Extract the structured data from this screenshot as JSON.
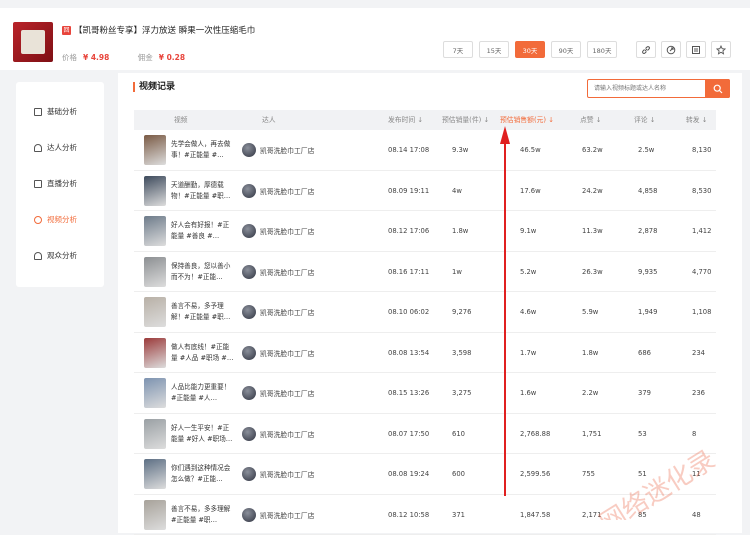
{
  "product": {
    "badge": "回",
    "title": "【凯哥粉丝专享】浮力放送 瞬果一次性压缩毛巾",
    "price_label": "价格",
    "price_value": "¥ 4.98",
    "commission_label": "佣金",
    "commission_value": "¥ 0.28"
  },
  "day_filters": [
    "7天",
    "15天",
    "30天",
    "90天",
    "180天"
  ],
  "active_filter": "30天",
  "tools": [
    "link-icon",
    "share-icon",
    "chart-icon",
    "star-icon"
  ],
  "sidebar": {
    "items": [
      {
        "label": "基础分析",
        "icon": "chart-doc-icon"
      },
      {
        "label": "达人分析",
        "icon": "user-icon"
      },
      {
        "label": "直播分析",
        "icon": "tv-icon"
      },
      {
        "label": "视频分析",
        "icon": "play-circle-icon",
        "active": true
      },
      {
        "label": "观众分析",
        "icon": "audience-icon"
      }
    ]
  },
  "section_title": "视频记录",
  "search": {
    "placeholder": "请输入视频标题或达人名称"
  },
  "table": {
    "headers": {
      "video": "视频",
      "creator": "达人",
      "time": "发布时间 ↓",
      "sales": "预估销量(件) ↓",
      "revenue": "预估销售额(元) ↓",
      "likes": "点赞 ↓",
      "comments": "评论 ↓",
      "shares": "转发 ↓"
    },
    "rows": [
      {
        "title": "先学会做人，再去做事！#正能量 #…",
        "creator": "凯哥洗脸巾工厂店",
        "time": "08.14 17:08",
        "sales": "9.3w",
        "revenue": "46.5w",
        "likes": "63.2w",
        "comments": "2.5w",
        "shares": "8,130",
        "thumb": "#7a5a44"
      },
      {
        "title": "天道酬勤，厚德载物！#正能量 #职…",
        "creator": "凯哥洗脸巾工厂店",
        "time": "08.09 19:11",
        "sales": "4w",
        "revenue": "17.6w",
        "likes": "24.2w",
        "comments": "4,858",
        "shares": "8,530",
        "thumb": "#3d4a5c"
      },
      {
        "title": "好人会有好报！#正能量 #善良 #…",
        "creator": "凯哥洗脸巾工厂店",
        "time": "08.12 17:06",
        "sales": "1.8w",
        "revenue": "9.1w",
        "likes": "11.3w",
        "comments": "2,878",
        "shares": "1,412",
        "thumb": "#6d7b8a"
      },
      {
        "title": "保持善良，您以善小而不为！#正能…",
        "creator": "凯哥洗脸巾工厂店",
        "time": "08.16 17:11",
        "sales": "1w",
        "revenue": "5.2w",
        "likes": "26.3w",
        "comments": "9,935",
        "shares": "4,770",
        "thumb": "#8c8f92"
      },
      {
        "title": "善言不易，多予理解！#正能量 #职…",
        "creator": "凯哥洗脸巾工厂店",
        "time": "08.10 06:02",
        "sales": "9,276",
        "revenue": "4.6w",
        "likes": "5.9w",
        "comments": "1,949",
        "shares": "1,108",
        "thumb": "#b8b0a6"
      },
      {
        "title": "做人有底线！#正能量 #人品 #职场 #…",
        "creator": "凯哥洗脸巾工厂店",
        "time": "08.08 13:54",
        "sales": "3,598",
        "revenue": "1.7w",
        "likes": "1.8w",
        "comments": "686",
        "shares": "234",
        "thumb": "#9b3a3a"
      },
      {
        "title": "人品比能力更重要！#正能量 #人…",
        "creator": "凯哥洗脸巾工厂店",
        "time": "08.15 13:26",
        "sales": "3,275",
        "revenue": "1.6w",
        "likes": "2.2w",
        "comments": "379",
        "shares": "236",
        "thumb": "#7d93b0"
      },
      {
        "title": "好人一生平安！#正能量 #好人 #职场…",
        "creator": "凯哥洗脸巾工厂店",
        "time": "08.07 17:50",
        "sales": "610",
        "revenue": "2,768.88",
        "likes": "1,751",
        "comments": "53",
        "shares": "8",
        "thumb": "#9aa0a4"
      },
      {
        "title": "你们遇到这种情况会怎么做？#正能…",
        "creator": "凯哥洗脸巾工厂店",
        "time": "08.08 19:24",
        "sales": "600",
        "revenue": "2,599.56",
        "likes": "755",
        "comments": "51",
        "shares": "11",
        "thumb": "#5d6f84"
      },
      {
        "title": "善言不易，多多理解#正能量 #职…",
        "creator": "凯哥洗脸巾工厂店",
        "time": "08.12 10:58",
        "sales": "371",
        "revenue": "1,847.58",
        "likes": "2,171",
        "comments": "85",
        "shares": "48",
        "thumb": "#a7a29a"
      }
    ]
  },
  "watermark": "网络迷化录"
}
